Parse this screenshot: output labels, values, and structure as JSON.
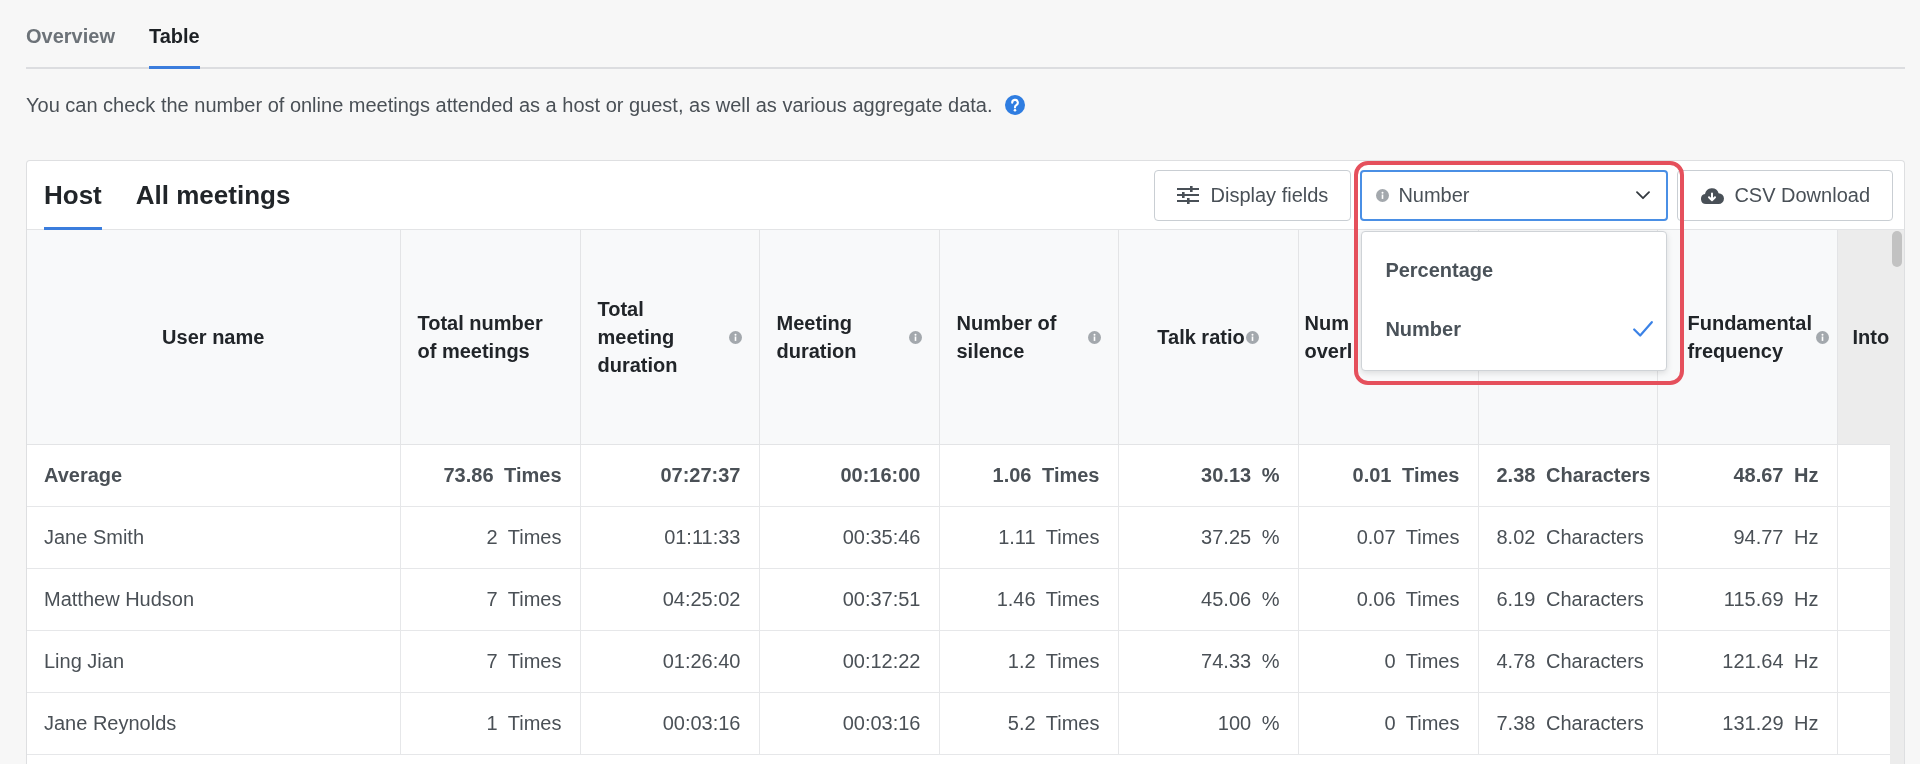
{
  "page_tabs": [
    {
      "label": "Overview",
      "selected": false
    },
    {
      "label": "Table",
      "selected": true
    }
  ],
  "description": "You can check the number of online meetings attended as a host or guest, as well as various aggregate data.",
  "card": {
    "view_tabs": [
      {
        "label": "Host",
        "selected": true
      },
      {
        "label": "All meetings",
        "selected": false
      }
    ],
    "display_fields_button": "Display fields",
    "unit_select": {
      "value": "Number",
      "expanded": true,
      "highlighted": true,
      "options": [
        {
          "label": "Percentage",
          "selected": false
        },
        {
          "label": "Number",
          "selected": true
        }
      ]
    },
    "csv_button": "CSV Download",
    "table": {
      "columns": [
        {
          "label": "User name",
          "info": false
        },
        {
          "label": "Total number of meetings",
          "info": false
        },
        {
          "label": "Total meeting duration",
          "info": true
        },
        {
          "label": "Meeting duration",
          "info": true
        },
        {
          "label": "Number of silence",
          "info": true
        },
        {
          "label": "Talk ratio",
          "info": true
        },
        {
          "label": "Num overl"
        },
        {},
        {
          "label": "Fundamental frequency",
          "info": true
        },
        {
          "label": "Into"
        }
      ],
      "rows": [
        {
          "kind": "summary",
          "cells": [
            "Average",
            "73.86 Times",
            "07:27:37",
            "00:16:00",
            "1.06 Times",
            "30.13 %",
            "0.01 Times",
            "2.38 Characters",
            "48.67 Hz"
          ]
        },
        {
          "kind": "user",
          "cells": [
            "Jane Smith",
            "2 Times",
            "01:11:33",
            "00:35:46",
            "1.11 Times",
            "37.25 %",
            "0.07 Times",
            "8.02 Characters",
            "94.77 Hz"
          ]
        },
        {
          "kind": "user",
          "cells": [
            "Matthew Hudson",
            "7 Times",
            "04:25:02",
            "00:37:51",
            "1.46 Times",
            "45.06 %",
            "0.06 Times",
            "6.19 Characters",
            "115.69 Hz"
          ]
        },
        {
          "kind": "user",
          "cells": [
            "Ling Jian",
            "7 Times",
            "01:26:40",
            "00:12:22",
            "1.2 Times",
            "74.33 %",
            "0 Times",
            "4.78 Characters",
            "121.64 Hz"
          ]
        },
        {
          "kind": "user",
          "cells": [
            "Jane Reynolds",
            "1 Times",
            "00:03:16",
            "00:03:16",
            "5.2 Times",
            "100 %",
            "0 Times",
            "7.38 Characters",
            "131.29 Hz"
          ]
        }
      ]
    }
  }
}
